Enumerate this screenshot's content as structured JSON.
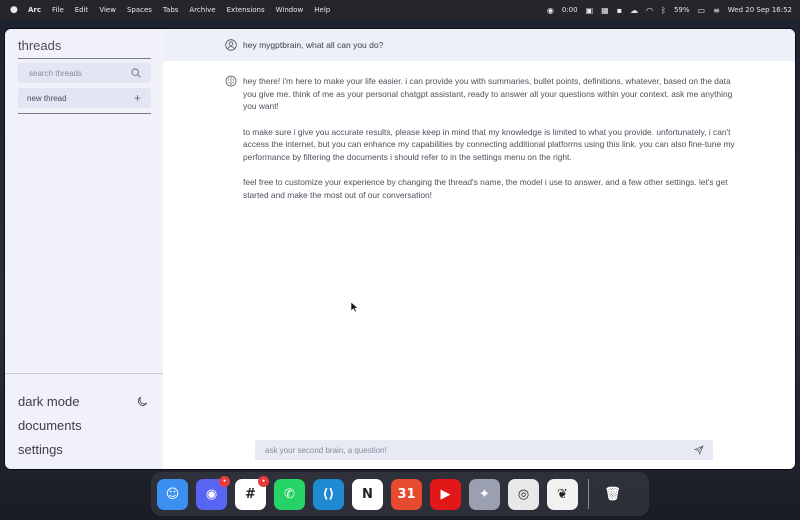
{
  "menubar": {
    "menus": [
      "Arc",
      "File",
      "Edit",
      "View",
      "Spaces",
      "Tabs",
      "Archive",
      "Extensions",
      "Window",
      "Help"
    ],
    "status": {
      "timer": "0:00",
      "battery": "59%",
      "datetime": "Wed 20 Sep 16:52"
    }
  },
  "sidebar": {
    "title": "threads",
    "search_placeholder": "search threads",
    "new_thread_label": "new thread",
    "bottom": {
      "dark_mode": "dark mode",
      "documents": "documents",
      "settings": "settings"
    }
  },
  "conversation": {
    "user_message": "hey mygptbrain, what all can you do?",
    "reply_paragraphs": [
      "hey there! i'm here to make your life easier. i can provide you with summaries, bullet points, definitions, whatever, based on the data you give me. think of me as your personal chatgpt assistant, ready to answer all your questions within your context. ask me anything you want!",
      "to make sure i give you accurate results, please keep in mind that my knowledge is limited to what you provide. unfortunately, i can't access the internet, but you can enhance my capabilities by connecting additional platforms using this link. you can also fine-tune my performance by filtering the documents i should refer to in the settings menu on the right.",
      "feel free to customize your experience by changing the thread's name, the model i use to answer, and a few other settings. let's get started and make the most out of our conversation!"
    ]
  },
  "composer": {
    "placeholder": "ask your second brain, a question!"
  },
  "dock": {
    "apps": [
      {
        "name": "finder",
        "color": "#3b8ff0",
        "glyph": "☺",
        "badge": ""
      },
      {
        "name": "discord",
        "color": "#5865f2",
        "glyph": "◉",
        "badge": "•"
      },
      {
        "name": "slack",
        "color": "#ffffff",
        "glyph": "#",
        "badge": "•"
      },
      {
        "name": "whatsapp",
        "color": "#25d366",
        "glyph": "✆",
        "badge": ""
      },
      {
        "name": "vscode",
        "color": "#1f8ad2",
        "glyph": "⟨⟩",
        "badge": ""
      },
      {
        "name": "notion",
        "color": "#ffffff",
        "glyph": "N",
        "badge": ""
      },
      {
        "name": "calendar",
        "color": "#e84a2f",
        "glyph": "31",
        "badge": ""
      },
      {
        "name": "youtube-music",
        "color": "#e21818",
        "glyph": "▶",
        "badge": ""
      },
      {
        "name": "xcode-tools",
        "color": "#9aa0b0",
        "glyph": "✦",
        "badge": ""
      },
      {
        "name": "chrome",
        "color": "#e8e8e8",
        "glyph": "◎",
        "badge": ""
      },
      {
        "name": "mongodb-compass",
        "color": "#f2f2f2",
        "glyph": "❦",
        "badge": ""
      }
    ],
    "trash": {
      "name": "trash",
      "color": "#9a9ca6",
      "glyph": "🗑"
    }
  }
}
